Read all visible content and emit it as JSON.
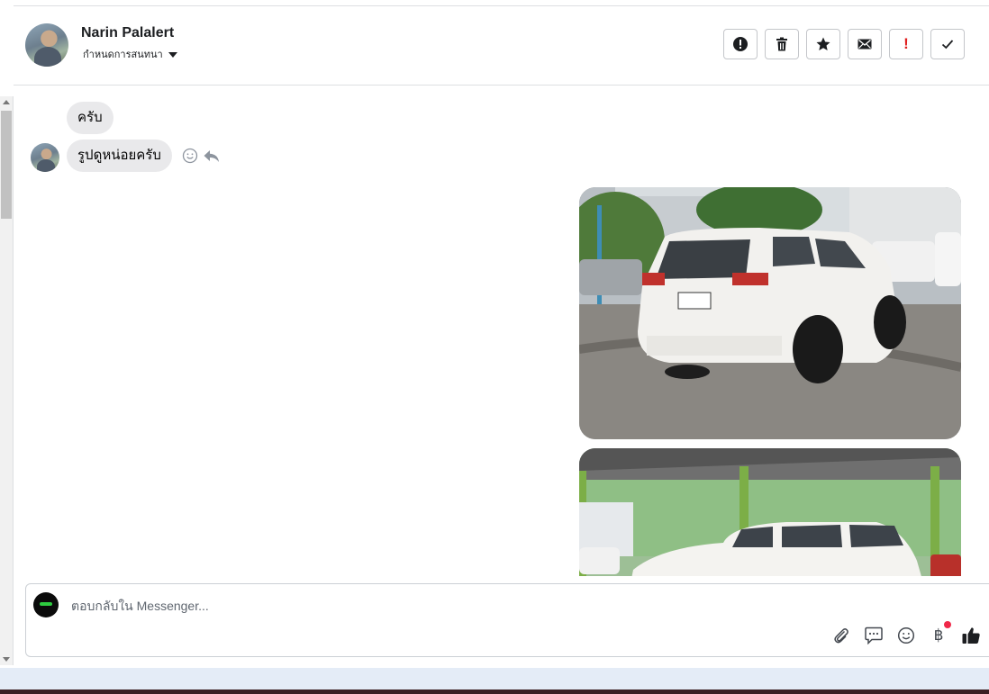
{
  "header": {
    "contact_name": "Narin Palalert",
    "subtitle": "กำหนดการสนทนา",
    "toolbar": [
      {
        "name": "report-button",
        "icon": "exclamation-circle-icon"
      },
      {
        "name": "delete-button",
        "icon": "trash-icon"
      },
      {
        "name": "star-button",
        "icon": "star-icon"
      },
      {
        "name": "mark-unread-button",
        "icon": "envelope-icon"
      },
      {
        "name": "spam-button",
        "icon": "red-exclamation-icon",
        "color": "#e02020"
      },
      {
        "name": "mark-done-button",
        "icon": "checkmark-icon"
      }
    ]
  },
  "messages": [
    {
      "from": "contact",
      "text": "ครับ"
    },
    {
      "from": "contact",
      "text": "รูปดูหน่อยครับ",
      "actions": [
        "smiley-icon",
        "reply-icon"
      ]
    },
    {
      "from": "page",
      "type": "image",
      "depicts": "white SUV rear view in parking lot"
    },
    {
      "from": "page",
      "type": "image",
      "depicts": "white SUV side view under shelter"
    }
  ],
  "composer": {
    "placeholder": "ตอบกลับใน Messenger...",
    "tools": [
      "paperclip-icon",
      "saved-replies-icon",
      "emoji-icon",
      "baht-icon",
      "thumbs-up-icon"
    ],
    "baht_symbol": "฿"
  },
  "colors": {
    "bubble_bg": "#e9e9eb",
    "border": "#dddfe2",
    "notification_dot": "#f02849"
  }
}
